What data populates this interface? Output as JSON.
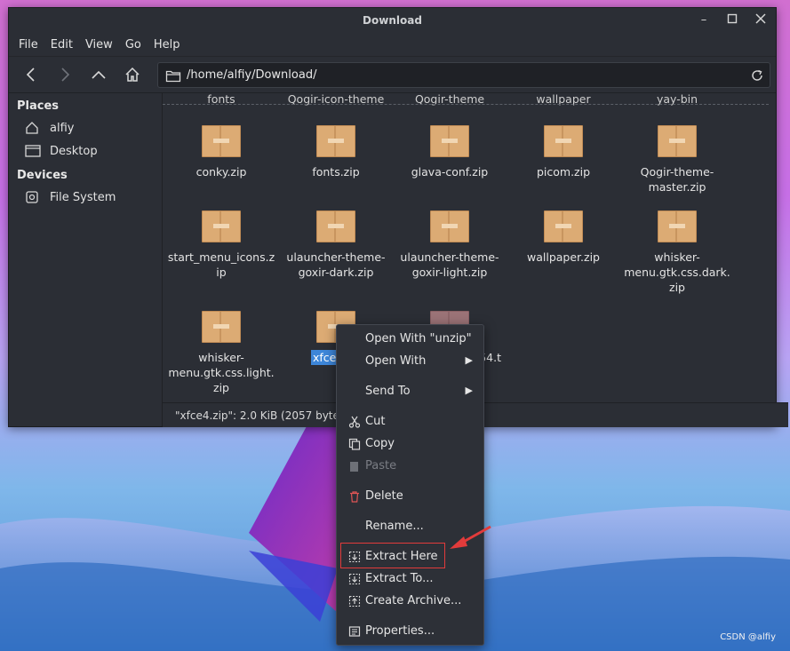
{
  "window": {
    "title": "Download",
    "menu": [
      "File",
      "Edit",
      "View",
      "Go",
      "Help"
    ],
    "address": "/home/alfiy/Download/"
  },
  "sidebar": {
    "places_heading": "Places",
    "places": [
      "alfiy",
      "Desktop"
    ],
    "devices_heading": "Devices",
    "devices": [
      "File System"
    ]
  },
  "files": {
    "top_partial": [
      "fonts",
      "Qogir-icon-theme",
      "Qogir-theme",
      "wallpaper",
      "yay-bin"
    ],
    "row1": [
      "conky.zip",
      "fonts.zip",
      "glava-conf.zip",
      "picom.zip",
      "Qogir-theme-\nmaster.zip"
    ],
    "row2": [
      "start_menu_icons.z\nip",
      "ulauncher-theme-\ngoxir-dark.zip",
      "ulauncher-theme-\ngoxir-light.zip",
      "wallpaper.zip",
      "whisker-\nmenu.gtk.css.dark.\nzip"
    ],
    "row3": [
      "whisker-\nmenu.gtk.css.light.\nzip",
      "xfce4",
      "54.t"
    ]
  },
  "status": "\"xfce4.zip\": 2.0 KiB (2057 bytes)",
  "context_menu": {
    "open_with_unzip": "Open With \"unzip\"",
    "open_with": "Open With",
    "send_to": "Send To",
    "cut": "Cut",
    "copy": "Copy",
    "paste": "Paste",
    "delete": "Delete",
    "rename": "Rename...",
    "extract_here": "Extract Here",
    "extract_to": "Extract To...",
    "create_archive": "Create Archive...",
    "properties": "Properties..."
  },
  "watermark": "CSDN @alfiy",
  "colors": {
    "selection": "#3d86d9",
    "highlight_box": "#e23b3b",
    "arrow": "#e23b3b"
  }
}
